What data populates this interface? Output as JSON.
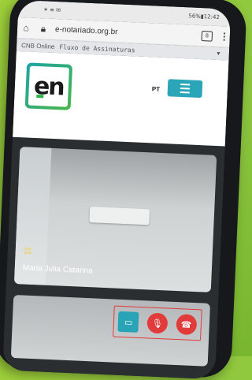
{
  "status_bar": {
    "left": "✶ ≡ ✉",
    "right": "56%▮12:42"
  },
  "browser": {
    "url": "e-notariado.org.br",
    "tab_count": "8",
    "home_icon": "home-icon",
    "lock_icon": "lock-icon",
    "menu_icon": "kebab-menu-icon"
  },
  "cnb_bar": {
    "brand": "CNB Online",
    "selected": "Fluxo de Assinaturas"
  },
  "header": {
    "logo_text": "en",
    "language": "PT"
  },
  "participant": {
    "name": "Maria Julia Catarina"
  },
  "controls": {
    "share_icon": "screen-share-icon",
    "mic_icon": "mic-muted-icon",
    "hangup_icon": "hangup-icon"
  },
  "colors": {
    "accent": "#2aa6b8",
    "danger": "#e23b3b",
    "background": "#8cc63f"
  }
}
